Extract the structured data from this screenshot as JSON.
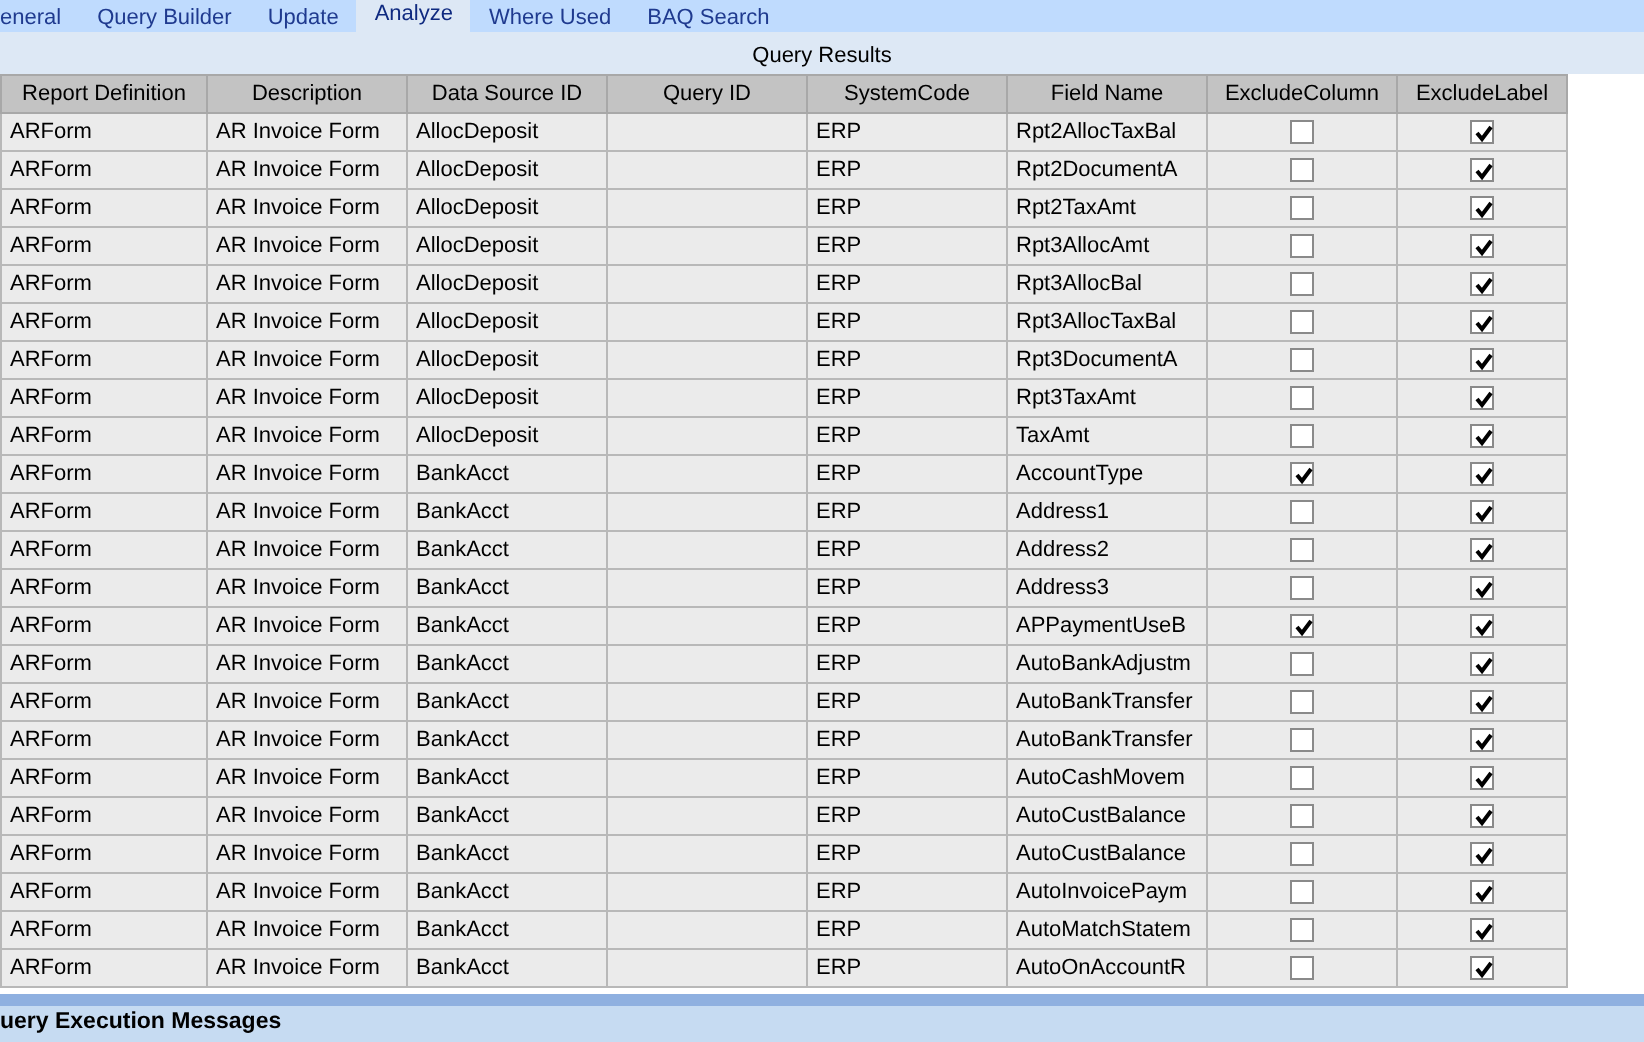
{
  "tabs": [
    {
      "label": "eneral",
      "selected": false
    },
    {
      "label": "Query Builder",
      "selected": false
    },
    {
      "label": "Update",
      "selected": false
    },
    {
      "label": "Analyze",
      "selected": true
    },
    {
      "label": "Where Used",
      "selected": false
    },
    {
      "label": "BAQ Search",
      "selected": false
    }
  ],
  "results_panel": {
    "title": "Query Results",
    "columns": [
      "Report Definition",
      "Description",
      "Data Source ID",
      "Query ID",
      "SystemCode",
      "Field Name",
      "ExcludeColumn",
      "ExcludeLabel"
    ],
    "rows": [
      {
        "report_definition": "ARForm",
        "description": "AR Invoice Form",
        "data_source_id": "AllocDeposit",
        "system_code": "ERP",
        "field_name": "Rpt2AllocTaxBal",
        "exclude_column": false,
        "exclude_label": true
      },
      {
        "report_definition": "ARForm",
        "description": "AR Invoice Form",
        "data_source_id": "AllocDeposit",
        "system_code": "ERP",
        "field_name": "Rpt2DocumentA",
        "exclude_column": false,
        "exclude_label": true
      },
      {
        "report_definition": "ARForm",
        "description": "AR Invoice Form",
        "data_source_id": "AllocDeposit",
        "system_code": "ERP",
        "field_name": "Rpt2TaxAmt",
        "exclude_column": false,
        "exclude_label": true
      },
      {
        "report_definition": "ARForm",
        "description": "AR Invoice Form",
        "data_source_id": "AllocDeposit",
        "system_code": "ERP",
        "field_name": "Rpt3AllocAmt",
        "exclude_column": false,
        "exclude_label": true
      },
      {
        "report_definition": "ARForm",
        "description": "AR Invoice Form",
        "data_source_id": "AllocDeposit",
        "system_code": "ERP",
        "field_name": "Rpt3AllocBal",
        "exclude_column": false,
        "exclude_label": true
      },
      {
        "report_definition": "ARForm",
        "description": "AR Invoice Form",
        "data_source_id": "AllocDeposit",
        "system_code": "ERP",
        "field_name": "Rpt3AllocTaxBal",
        "exclude_column": false,
        "exclude_label": true
      },
      {
        "report_definition": "ARForm",
        "description": "AR Invoice Form",
        "data_source_id": "AllocDeposit",
        "system_code": "ERP",
        "field_name": "Rpt3DocumentA",
        "exclude_column": false,
        "exclude_label": true
      },
      {
        "report_definition": "ARForm",
        "description": "AR Invoice Form",
        "data_source_id": "AllocDeposit",
        "system_code": "ERP",
        "field_name": "Rpt3TaxAmt",
        "exclude_column": false,
        "exclude_label": true
      },
      {
        "report_definition": "ARForm",
        "description": "AR Invoice Form",
        "data_source_id": "AllocDeposit",
        "system_code": "ERP",
        "field_name": "TaxAmt",
        "exclude_column": false,
        "exclude_label": true
      },
      {
        "report_definition": "ARForm",
        "description": "AR Invoice Form",
        "data_source_id": "BankAcct",
        "system_code": "ERP",
        "field_name": "AccountType",
        "exclude_column": true,
        "exclude_label": true
      },
      {
        "report_definition": "ARForm",
        "description": "AR Invoice Form",
        "data_source_id": "BankAcct",
        "system_code": "ERP",
        "field_name": "Address1",
        "exclude_column": false,
        "exclude_label": true
      },
      {
        "report_definition": "ARForm",
        "description": "AR Invoice Form",
        "data_source_id": "BankAcct",
        "system_code": "ERP",
        "field_name": "Address2",
        "exclude_column": false,
        "exclude_label": true
      },
      {
        "report_definition": "ARForm",
        "description": "AR Invoice Form",
        "data_source_id": "BankAcct",
        "system_code": "ERP",
        "field_name": "Address3",
        "exclude_column": false,
        "exclude_label": true
      },
      {
        "report_definition": "ARForm",
        "description": "AR Invoice Form",
        "data_source_id": "BankAcct",
        "system_code": "ERP",
        "field_name": "APPaymentUseB",
        "exclude_column": true,
        "exclude_label": true
      },
      {
        "report_definition": "ARForm",
        "description": "AR Invoice Form",
        "data_source_id": "BankAcct",
        "system_code": "ERP",
        "field_name": "AutoBankAdjustm",
        "exclude_column": false,
        "exclude_label": true
      },
      {
        "report_definition": "ARForm",
        "description": "AR Invoice Form",
        "data_source_id": "BankAcct",
        "system_code": "ERP",
        "field_name": "AutoBankTransfer",
        "exclude_column": false,
        "exclude_label": true
      },
      {
        "report_definition": "ARForm",
        "description": "AR Invoice Form",
        "data_source_id": "BankAcct",
        "system_code": "ERP",
        "field_name": "AutoBankTransfer",
        "exclude_column": false,
        "exclude_label": true
      },
      {
        "report_definition": "ARForm",
        "description": "AR Invoice Form",
        "data_source_id": "BankAcct",
        "system_code": "ERP",
        "field_name": "AutoCashMovem",
        "exclude_column": false,
        "exclude_label": true
      },
      {
        "report_definition": "ARForm",
        "description": "AR Invoice Form",
        "data_source_id": "BankAcct",
        "system_code": "ERP",
        "field_name": "AutoCustBalance",
        "exclude_column": false,
        "exclude_label": true
      },
      {
        "report_definition": "ARForm",
        "description": "AR Invoice Form",
        "data_source_id": "BankAcct",
        "system_code": "ERP",
        "field_name": "AutoCustBalance",
        "exclude_column": false,
        "exclude_label": true
      },
      {
        "report_definition": "ARForm",
        "description": "AR Invoice Form",
        "data_source_id": "BankAcct",
        "system_code": "ERP",
        "field_name": "AutoInvoicePaym",
        "exclude_column": false,
        "exclude_label": true
      },
      {
        "report_definition": "ARForm",
        "description": "AR Invoice Form",
        "data_source_id": "BankAcct",
        "system_code": "ERP",
        "field_name": "AutoMatchStatem",
        "exclude_column": false,
        "exclude_label": true
      },
      {
        "report_definition": "ARForm",
        "description": "AR Invoice Form",
        "data_source_id": "BankAcct",
        "system_code": "ERP",
        "field_name": "AutoOnAccountR",
        "exclude_column": false,
        "exclude_label": true
      }
    ]
  },
  "messages_panel": {
    "title": "uery Execution Messages"
  }
}
